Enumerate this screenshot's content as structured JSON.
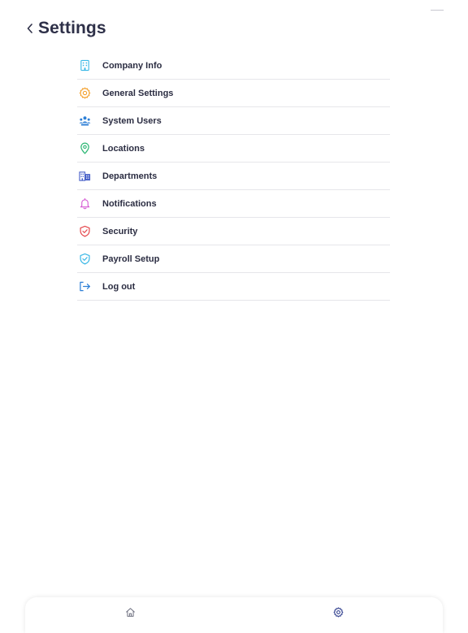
{
  "header": {
    "title": "Settings",
    "back_icon": "chevron-left-icon"
  },
  "menu": {
    "items": [
      {
        "label": "Company Info",
        "icon": "building-icon",
        "color": "#3bb8e6"
      },
      {
        "label": "General Settings",
        "icon": "gear-icon",
        "color": "#f39a1e"
      },
      {
        "label": "System Users",
        "icon": "users-icon",
        "color": "#2d7fd6"
      },
      {
        "label": "Locations",
        "icon": "map-pin-icon",
        "color": "#2bb673"
      },
      {
        "label": "Departments",
        "icon": "departments-icon",
        "color": "#4a62c9"
      },
      {
        "label": "Notifications",
        "icon": "bell-icon",
        "color": "#d65bd4"
      },
      {
        "label": "Security",
        "icon": "shield-check-icon",
        "color": "#e5484d"
      },
      {
        "label": "Payroll Setup",
        "icon": "shield-check-icon",
        "color": "#3bb8e6"
      },
      {
        "label": "Log out",
        "icon": "logout-icon",
        "color": "#2d7fd6"
      }
    ]
  },
  "tab_bar": {
    "tabs": [
      {
        "icon": "home-icon",
        "active": false
      },
      {
        "icon": "gear-icon",
        "active": true
      }
    ],
    "active_color": "#2d3c8c",
    "inactive_color": "#6b6d7d"
  }
}
